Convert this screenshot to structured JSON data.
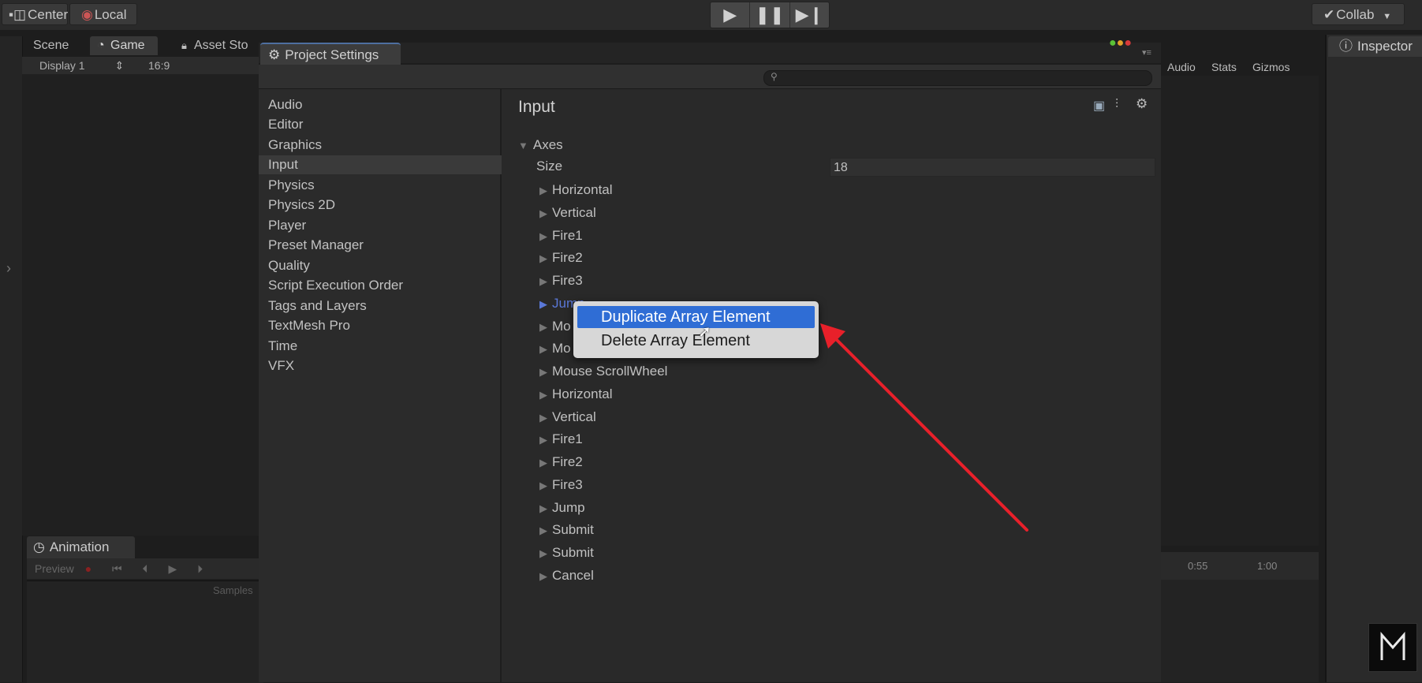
{
  "toolbar": {
    "pivot_label": "Center",
    "space_label": "Local",
    "collab_label": "Collab",
    "play_icons": [
      "▶",
      "❚❚",
      "▶❙"
    ]
  },
  "scene_panel": {
    "tabs": [
      "Scene",
      "Game",
      "Asset Sto"
    ],
    "display": "Display 1",
    "aspect": "16:9"
  },
  "animation": {
    "tab_label": "Animation",
    "preview_label": "Preview",
    "samples_label": "Samples"
  },
  "right_panel": {
    "tools": [
      "Audio",
      "Stats",
      "Gizmos"
    ],
    "timeline_ticks": [
      "0:55",
      "1:00"
    ],
    "inspector_label": "Inspector"
  },
  "project_settings": {
    "window_title": "Project Settings",
    "sidebar": [
      "Audio",
      "Editor",
      "Graphics",
      "Input",
      "Physics",
      "Physics 2D",
      "Player",
      "Preset Manager",
      "Quality",
      "Script Execution Order",
      "Tags and Layers",
      "TextMesh Pro",
      "Time",
      "VFX"
    ],
    "selected": "Input",
    "page_title": "Input",
    "axes_label": "Axes",
    "size_label": "Size",
    "size_value": "18",
    "axes": [
      "Horizontal",
      "Vertical",
      "Fire1",
      "Fire2",
      "Fire3",
      "Jump",
      "Mo",
      "Mo",
      "Mouse ScrollWheel",
      "Horizontal",
      "Vertical",
      "Fire1",
      "Fire2",
      "Fire3",
      "Jump",
      "Submit",
      "Submit",
      "Cancel"
    ]
  },
  "context_menu": {
    "items": [
      "Duplicate Array Element",
      "Delete Array Element"
    ],
    "highlighted": "Duplicate Array Element"
  },
  "colors": {
    "highlight": "#2f6dd5",
    "annotation_arrow": "#e8202a"
  }
}
